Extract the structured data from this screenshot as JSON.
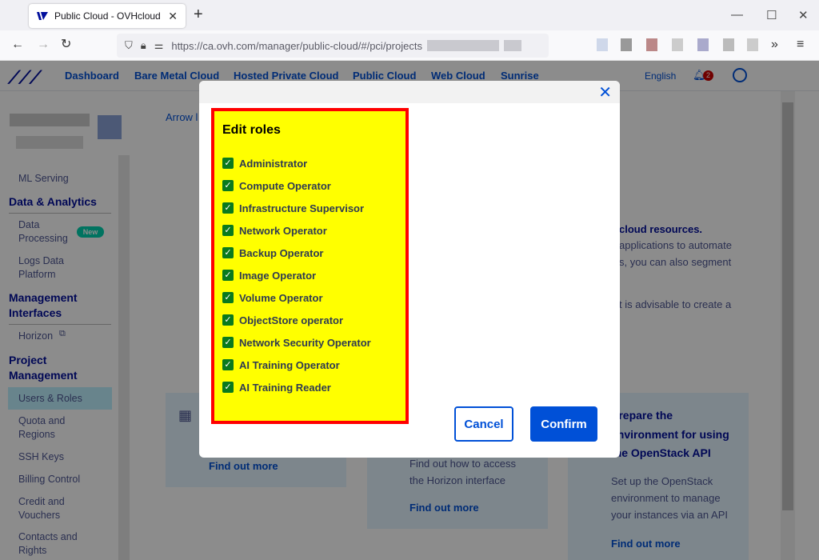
{
  "browser": {
    "tab_title": "Public Cloud - OVHcloud",
    "url": "https://ca.ovh.com/manager/public-cloud/#/pci/projects"
  },
  "topnav": {
    "items": [
      "Dashboard",
      "Bare Metal Cloud",
      "Hosted Private Cloud",
      "Public Cloud",
      "Web Cloud",
      "Sunrise"
    ],
    "language": "English",
    "notifications": "2"
  },
  "sidebar": {
    "ml_serving": "ML Serving",
    "data_analytics": "Data & Analytics",
    "data_processing": [
      "Data",
      "Processing"
    ],
    "new_badge": "New",
    "logs_data": [
      "Logs Data",
      "Platform"
    ],
    "management_interfaces": [
      "Management",
      "Interfaces"
    ],
    "horizon": "Horizon",
    "project_management": [
      "Project",
      "Management"
    ],
    "users_roles": "Users & Roles",
    "quota": [
      "Quota and",
      "Regions"
    ],
    "ssh_keys": "SSH Keys",
    "billing": "Billing Control",
    "credit": [
      "Credit and",
      "Vouchers"
    ],
    "contacts": [
      "Contacts and",
      "Rights"
    ]
  },
  "main": {
    "arrow_text": "Arrow l",
    "right_text": [
      "cloud resources.",
      "applications to automate",
      "s, you can also segment",
      "t is advisable to create a"
    ],
    "card1_link": "Find out more",
    "card2_text": [
      "Find out how to access",
      "the Horizon interface"
    ],
    "card2_link": "Find out more",
    "card3_title": [
      "Prepare the",
      "environment for using",
      "the OpenStack API"
    ],
    "card3_text": [
      "Set up the OpenStack",
      "environment to manage",
      "your instances via an API"
    ],
    "card3_link": "Find out more"
  },
  "modal": {
    "title": "Edit roles",
    "roles": [
      "Administrator",
      "Compute Operator",
      "Infrastructure Supervisor",
      "Network Operator",
      "Backup Operator",
      "Image Operator",
      "Volume Operator",
      "ObjectStore operator",
      "Network Security Operator",
      "AI Training Operator",
      "AI Training Reader"
    ],
    "cancel_label": "Cancel",
    "confirm_label": "Confirm"
  },
  "colors": {
    "accent": "#0050d7",
    "highlight": "#ffff00",
    "highlight_border": "#ff0000",
    "checkbox": "#0a7a1e"
  }
}
